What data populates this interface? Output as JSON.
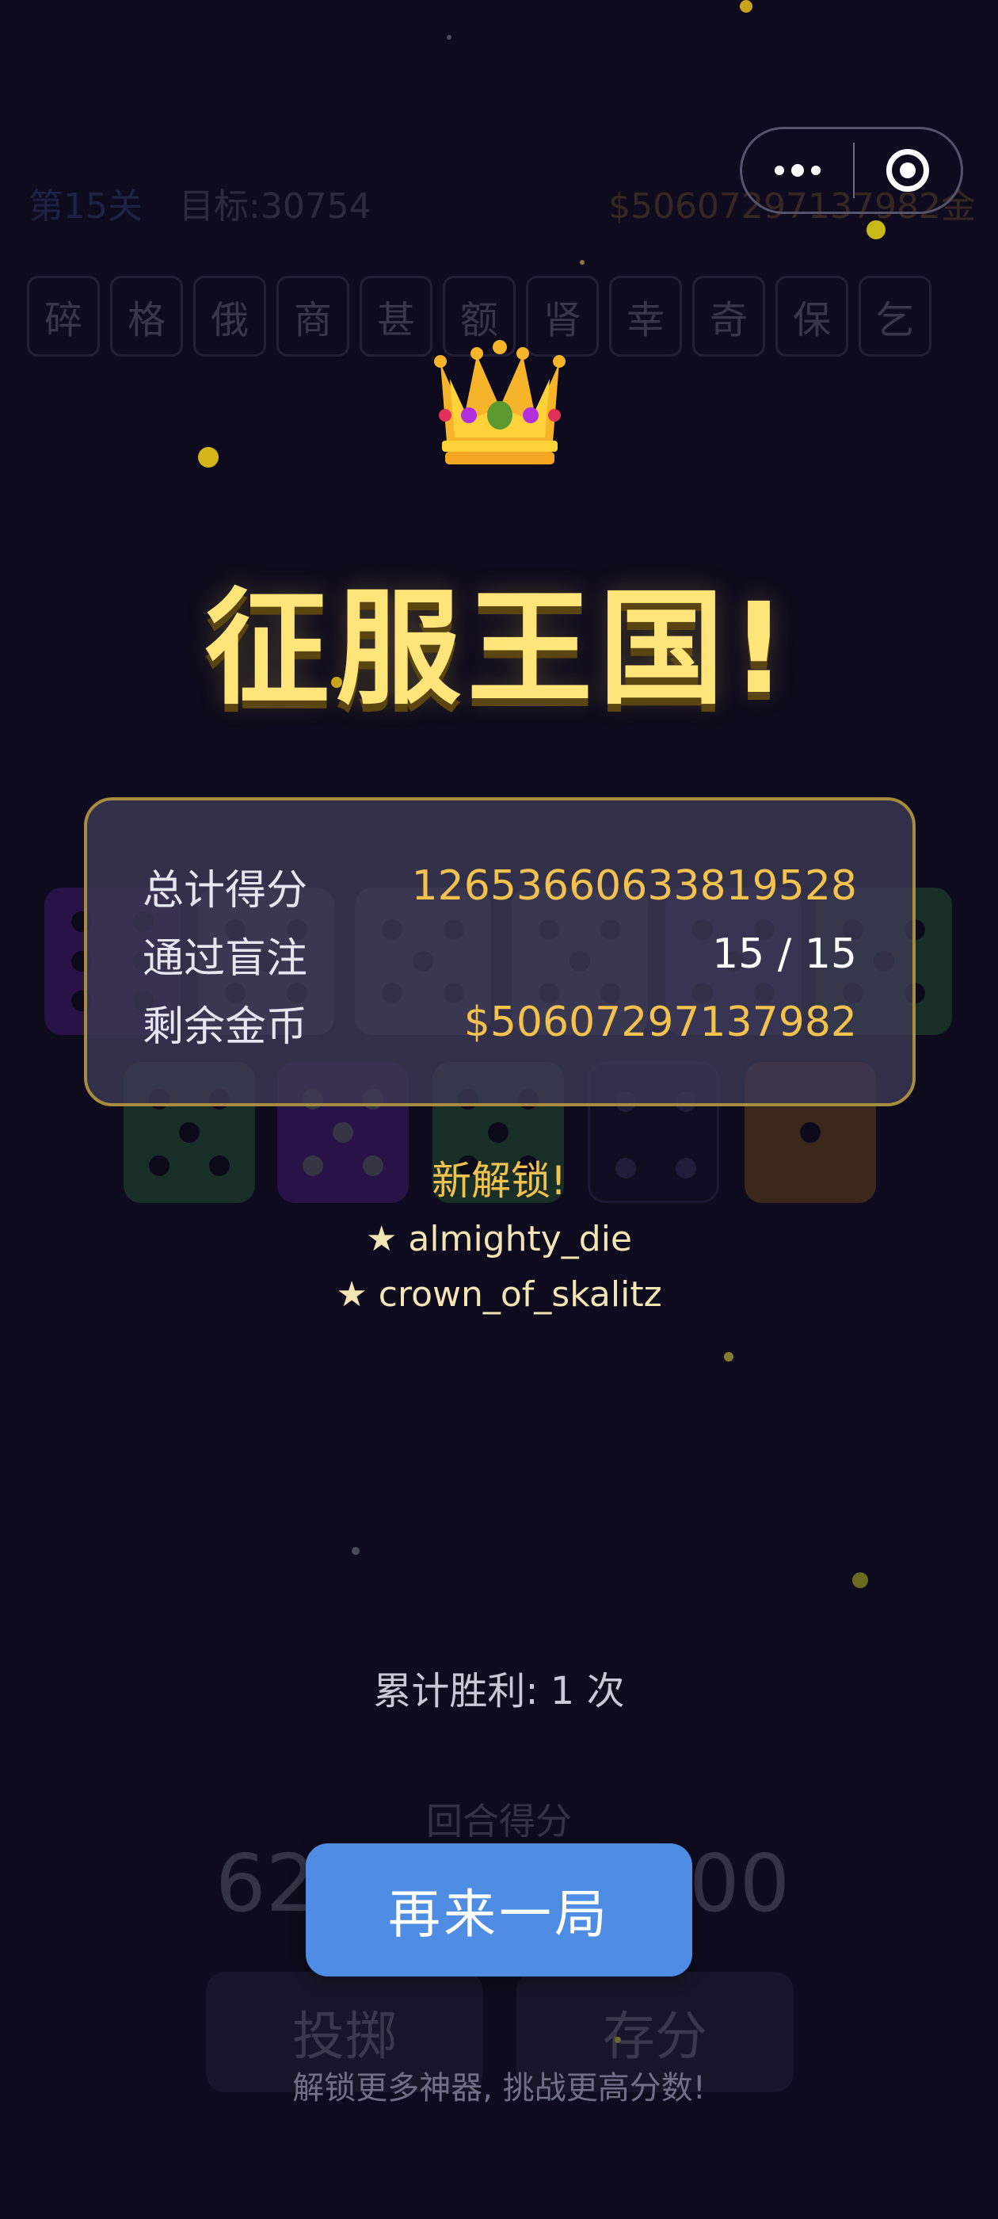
{
  "capsule": {
    "more_icon": "more-dots-icon",
    "target_icon": "target-icon"
  },
  "background": {
    "level": "第15关",
    "target": "目标:30754",
    "money": "$50607297137982金",
    "tiles": [
      "碎",
      "格",
      "俄",
      "商",
      "甚",
      "额",
      "肾",
      "幸",
      "奇",
      "保",
      "乞"
    ],
    "round_score_label": "回合得分",
    "left_score": "62",
    "right_score": "00",
    "roll_button": "投掷",
    "bank_button": "存分"
  },
  "overlay": {
    "crown_icon": "crown-icon",
    "title": "征服王国!",
    "stats": {
      "total_score_label": "总计得分",
      "total_score_value": "12653660633819528",
      "blinds_label": "通过盲注",
      "blinds_value": "15 / 15",
      "coins_label": "剩余金币",
      "coins_value": "$50607297137982"
    },
    "unlock_title": "新解锁!",
    "unlocks": [
      "★ almighty_die",
      "★ crown_of_skalitz"
    ],
    "total_wins": "累计胜利: 1 次",
    "play_again": "再来一局",
    "hint": "解锁更多神器, 挑战更高分数!"
  },
  "colors": {
    "background": "#0d0b1d",
    "gold": "#f2c14e",
    "title_yellow": "#ffe47a",
    "button_blue": "#4f8ce4"
  }
}
